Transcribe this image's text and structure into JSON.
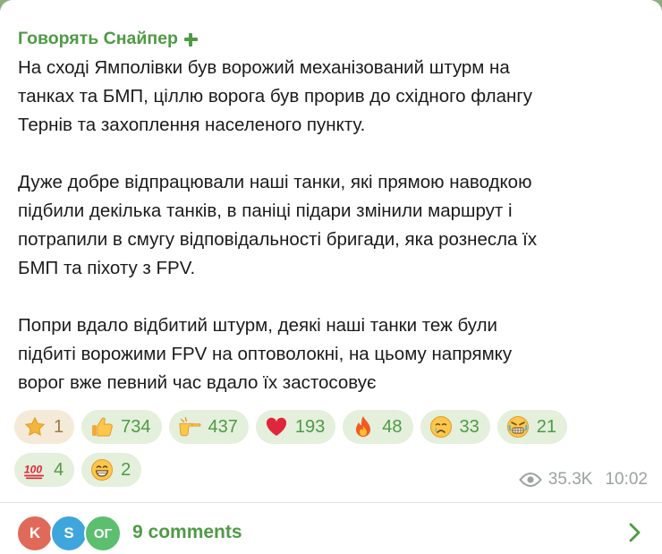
{
  "post": {
    "author": "Говорять Снайпер",
    "paragraphs": [
      [
        "На сході Ямполівки був ворожий механізований штурм на",
        "танках та БМП, ціллю ворога був прорив до східного флангу",
        "Тернів та захоплення населеного пункту."
      ],
      [
        "Дуже добре відпрацювали наші танки, які прямою наводкою",
        "підбили декілька танків, в паніці підари змінили маршрут і",
        "потрапили в смугу відповідальності бригади, яка рознесла їх",
        "БМП та піхоту з FPV."
      ],
      [
        "Попри вдало відбитий штурм, деякі наші танки теж були",
        "підбиті ворожими FPV на оптоволокні, на цьому напрямку",
        "ворог вже певний час вдало їх застосовує"
      ]
    ]
  },
  "reactions": [
    {
      "icon": "star-icon",
      "count": "1",
      "mine": true
    },
    {
      "icon": "thumbs-up-icon",
      "count": "734"
    },
    {
      "icon": "pointing-hand-icon",
      "count": "437"
    },
    {
      "icon": "red-heart-icon",
      "count": "193"
    },
    {
      "icon": "fire-icon",
      "count": "48"
    },
    {
      "icon": "crying-face-icon",
      "count": "33"
    },
    {
      "icon": "angry-face-icon",
      "count": "21"
    },
    {
      "icon": "hundred-points-icon",
      "count": "4"
    },
    {
      "icon": "grinning-face-icon",
      "count": "2"
    }
  ],
  "meta": {
    "views": "35.3K",
    "time": "10:02"
  },
  "comments": {
    "label": "9 comments",
    "avatars": [
      {
        "initials": "K",
        "color": "#e06a5a"
      },
      {
        "initials": "S",
        "color": "#3ea6dc"
      },
      {
        "initials": "ОГ",
        "color": "#5cbf6f"
      }
    ]
  },
  "colors": {
    "accent": "#4f9a45",
    "reaction_bg": "#e4efdc",
    "meta": "#9aa3a0"
  }
}
